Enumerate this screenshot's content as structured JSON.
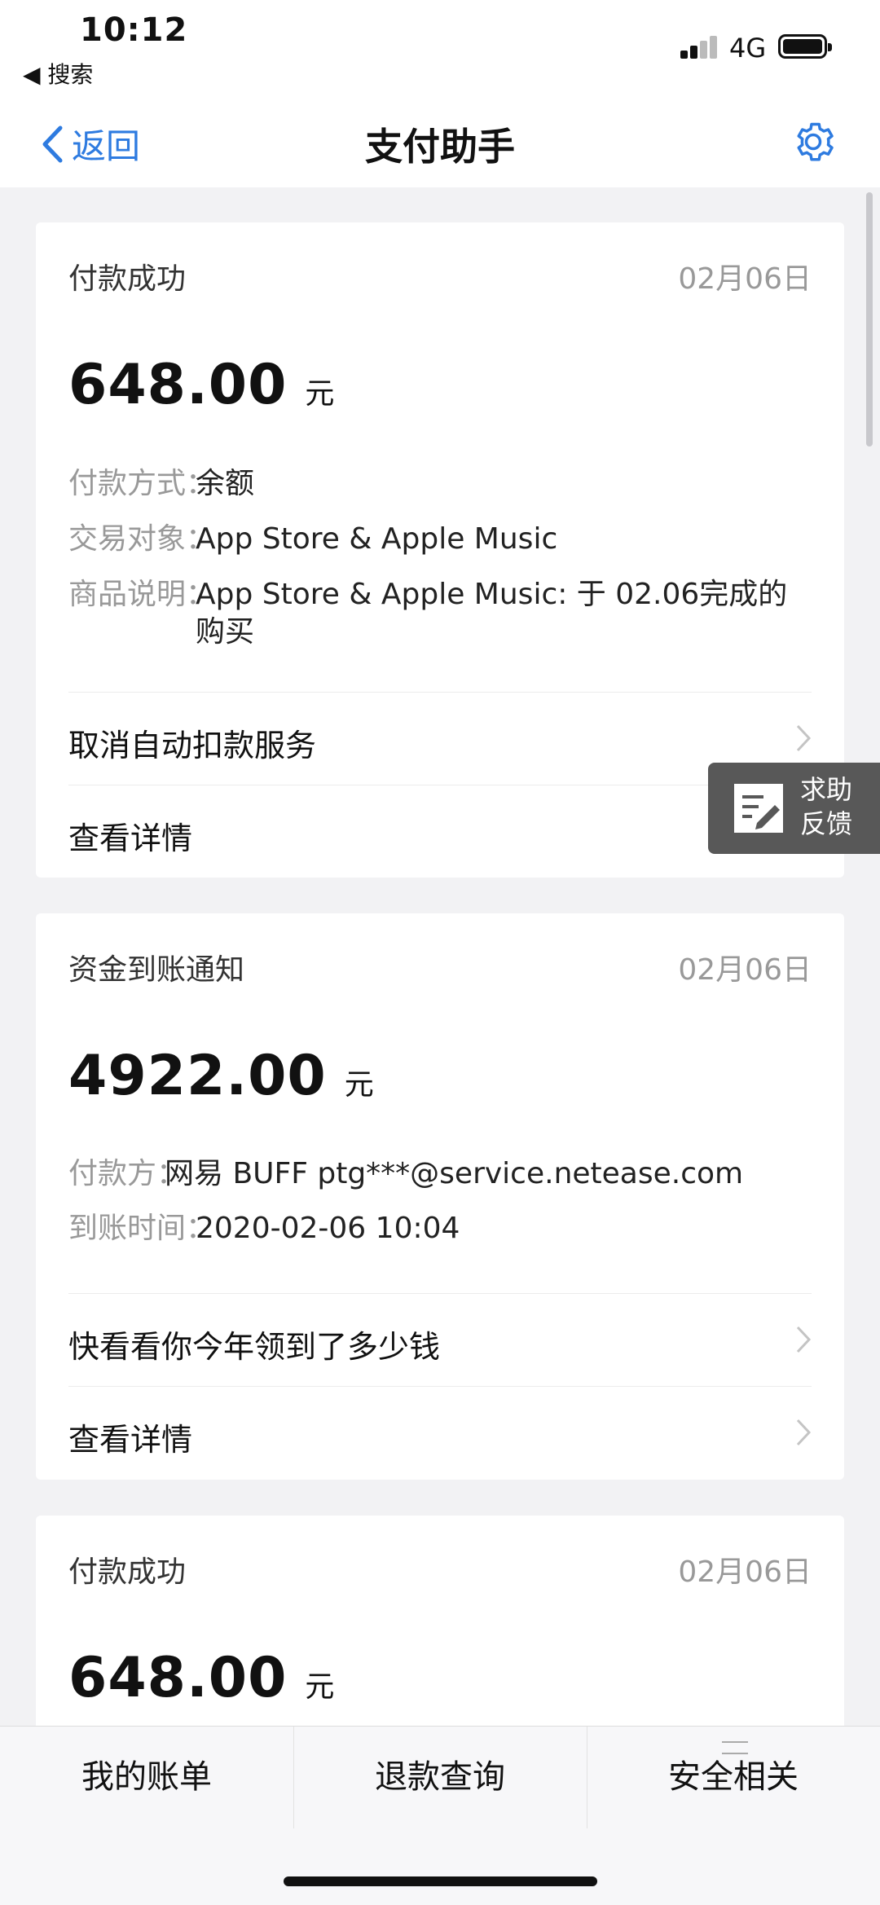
{
  "status_bar": {
    "time": "10:12",
    "back_app": "◀ 搜索",
    "network": "4G"
  },
  "nav": {
    "back_label": "返回",
    "title": "支付助手"
  },
  "cards": [
    {
      "type": "付款成功",
      "date": "02月06日",
      "amount": "648.00",
      "unit": "元",
      "rows": [
        {
          "key": "付款方式：",
          "value": "余额"
        },
        {
          "key": "交易对象：",
          "value": "App Store & Apple Music"
        },
        {
          "key": "商品说明：",
          "value": "App Store & Apple Music: 于 02.06完成的购买"
        }
      ],
      "actions": [
        "取消自动扣款服务",
        "查看详情"
      ]
    },
    {
      "type": "资金到账通知",
      "date": "02月06日",
      "amount": "4922.00",
      "unit": "元",
      "rows": [
        {
          "key": "付款方：",
          "value": "网易 BUFF ptg***@service.netease.com"
        },
        {
          "key": "到账时间：",
          "value": "2020-02-06 10:04"
        }
      ],
      "actions": [
        "快看看你今年领到了多少钱",
        "查看详情"
      ]
    },
    {
      "type": "付款成功",
      "date": "02月06日",
      "amount": "648.00",
      "unit": "元"
    }
  ],
  "help_float": {
    "line1": "求助",
    "line2": "反馈"
  },
  "tabs": [
    "我的账单",
    "退款查询",
    "安全相关"
  ],
  "colors": {
    "accent": "#2e7be0",
    "background": "#f2f2f4",
    "help_bg": "#585858"
  }
}
